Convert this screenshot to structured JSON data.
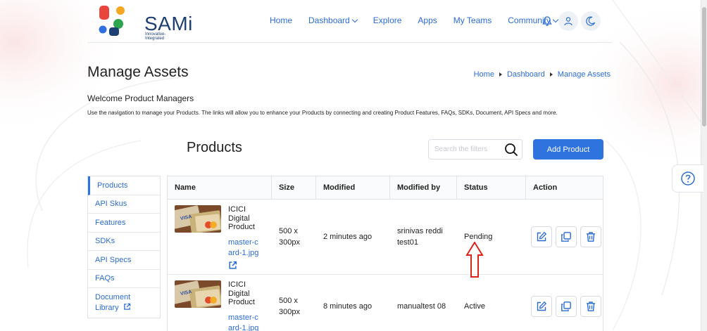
{
  "brand": {
    "name": "SAMi",
    "tagline": "Innovative-Integrated"
  },
  "nav": [
    {
      "label": "Home",
      "dropdown": false
    },
    {
      "label": "Dashboard",
      "dropdown": true
    },
    {
      "label": "Explore",
      "dropdown": false
    },
    {
      "label": "Apps",
      "dropdown": false
    },
    {
      "label": "My Teams",
      "dropdown": false
    },
    {
      "label": "Community",
      "dropdown": true
    }
  ],
  "page": {
    "title": "Manage Assets",
    "welcome": "Welcome Product Managers",
    "description": "Use the navigation to manage your Products. The links will allow you to enhance your Products by connecting and creating Product Features, FAQs, SDKs, Document, API Specs and more."
  },
  "breadcrumb": [
    "Home",
    "Dashboard",
    "Manage Assets"
  ],
  "products": {
    "heading": "Products",
    "search_placeholder": "Search the filters",
    "add_label": "Add Product"
  },
  "sidebar": [
    {
      "label": "Products",
      "active": true
    },
    {
      "label": "API Skus"
    },
    {
      "label": "Features"
    },
    {
      "label": "SDKs"
    },
    {
      "label": "API Specs"
    },
    {
      "label": "FAQs"
    },
    {
      "label": "Document Library",
      "external": true
    }
  ],
  "table": {
    "columns": [
      "Name",
      "Size",
      "Modified",
      "Modified by",
      "Status",
      "Action"
    ],
    "rows": [
      {
        "name": "ICICI Digital Product",
        "file": "master-card-1.jpg",
        "size": "500 x 300px",
        "modified": "2 minutes ago",
        "modified_by": "srinivas reddi test01",
        "status": "Pending"
      },
      {
        "name": "ICICI Digital Product",
        "file": "master-card-1.jpg",
        "size": "500 x 300px",
        "modified": "8 minutes ago",
        "modified_by": "manualtest 08",
        "status": "Active"
      }
    ]
  },
  "colors": {
    "accent": "#2f74de",
    "link": "#2b6cd4",
    "brand_navy": "#1e3f73",
    "annotation_red": "#d9261c"
  }
}
